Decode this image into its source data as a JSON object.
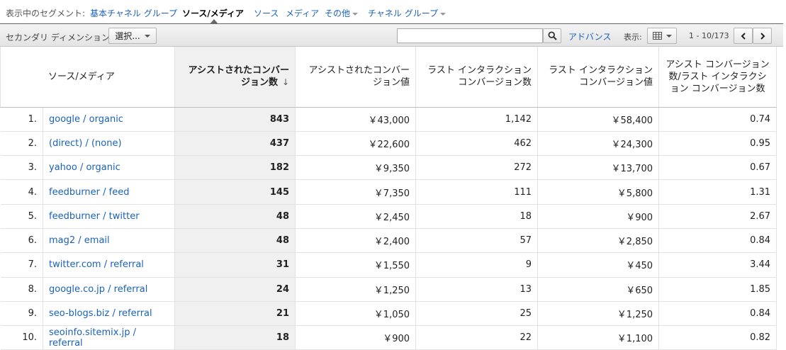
{
  "segments": {
    "label": "表示中のセグメント:",
    "items": [
      {
        "label": "基本チャネル グループ",
        "active": false,
        "dropdown": false
      },
      {
        "label": "ソース/メディア",
        "active": true,
        "dropdown": false
      },
      {
        "label": "ソース",
        "active": false,
        "dropdown": false
      },
      {
        "label": "メディア",
        "active": false,
        "dropdown": false
      },
      {
        "label": "その他",
        "active": false,
        "dropdown": true
      },
      {
        "label": "チャネル グループ",
        "active": false,
        "dropdown": true
      }
    ]
  },
  "toolbar": {
    "secondary_dimension_label": "セカンダリ ディメンション:",
    "select_label": "選択...",
    "search_value": "",
    "search_icon": "magnifier-icon",
    "advanced_label": "アドバンス",
    "display_label": "表示:",
    "view_icon": "grid-icon",
    "range_label": "1 - 10/173",
    "prev_icon": "chevron-left-icon",
    "next_icon": "chevron-right-icon"
  },
  "table": {
    "headers": {
      "dimension": "ソース/メディア",
      "assisted_conversions": "アシストされたコンバージョン数",
      "sort_arrow": "↓",
      "assisted_conversion_value": "アシストされたコンバージョン値",
      "last_interaction_conversions": "ラスト インタラクション コンバージョン数",
      "last_interaction_conversion_value": "ラスト インタラクション コンバージョン値",
      "ratio": "アシスト コンバージョン数/ラスト インタラクション コンバージョン数"
    },
    "rows": [
      {
        "idx": "1.",
        "name": "google / organic",
        "assisted": "843",
        "assisted_value": "￥43,000",
        "last": "1,142",
        "last_value": "￥58,400",
        "ratio": "0.74"
      },
      {
        "idx": "2.",
        "name": "(direct) / (none)",
        "assisted": "437",
        "assisted_value": "￥22,600",
        "last": "462",
        "last_value": "￥24,300",
        "ratio": "0.95"
      },
      {
        "idx": "3.",
        "name": "yahoo / organic",
        "assisted": "182",
        "assisted_value": "￥9,350",
        "last": "272",
        "last_value": "￥13,700",
        "ratio": "0.67"
      },
      {
        "idx": "4.",
        "name": "feedburner / feed",
        "assisted": "145",
        "assisted_value": "￥7,350",
        "last": "111",
        "last_value": "￥5,800",
        "ratio": "1.31"
      },
      {
        "idx": "5.",
        "name": "feedburner / twitter",
        "assisted": "48",
        "assisted_value": "￥2,450",
        "last": "18",
        "last_value": "￥900",
        "ratio": "2.67"
      },
      {
        "idx": "6.",
        "name": "mag2 / email",
        "assisted": "48",
        "assisted_value": "￥2,400",
        "last": "57",
        "last_value": "￥2,850",
        "ratio": "0.84"
      },
      {
        "idx": "7.",
        "name": "twitter.com / referral",
        "assisted": "31",
        "assisted_value": "￥1,550",
        "last": "9",
        "last_value": "￥450",
        "ratio": "3.44"
      },
      {
        "idx": "8.",
        "name": "google.co.jp / referral",
        "assisted": "24",
        "assisted_value": "￥1,250",
        "last": "13",
        "last_value": "￥650",
        "ratio": "1.85"
      },
      {
        "idx": "9.",
        "name": "seo-blogs.biz / referral",
        "assisted": "21",
        "assisted_value": "￥1,050",
        "last": "25",
        "last_value": "￥1,250",
        "ratio": "0.84"
      },
      {
        "idx": "10.",
        "name": "seoinfo.sitemix.jp / referral",
        "assisted": "18",
        "assisted_value": "￥900",
        "last": "22",
        "last_value": "￥1,100",
        "ratio": "0.82"
      }
    ]
  },
  "colors": {
    "link": "#1a62b8",
    "sorted_column_bg": "#f0f0f0"
  }
}
